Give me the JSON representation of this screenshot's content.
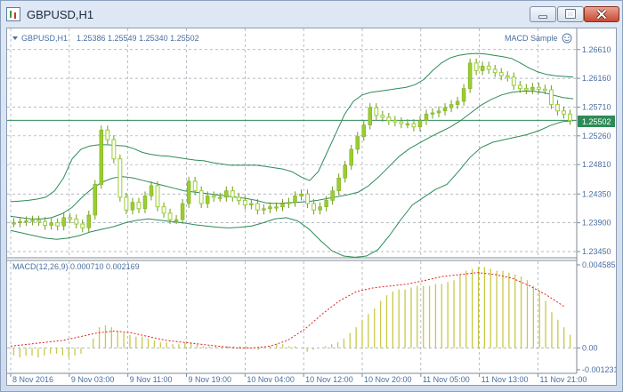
{
  "window": {
    "title": "GBPUSD,H1",
    "icon": "chart-window-icon"
  },
  "main_header": {
    "symbol": "GBPUSD,H1",
    "ohlc": "1.25386 1.25549 1.25340 1.25502",
    "indicator_name": "MACD Sample"
  },
  "macd_header": {
    "label": "MACD(12,26,9) 0.000710 0.002169"
  },
  "current_price": "1.25502",
  "colors": {
    "candle_bull": "#9acd32",
    "candle_bear": "#9acd32",
    "bands": "#2e8b57",
    "price_line": "#2e8b57",
    "macd_hist": "#c8c84a",
    "macd_signal": "#e02020",
    "grid": "#9aa3ad",
    "text": "#4a6fa0"
  },
  "chart_data": [
    {
      "type": "candlestick",
      "title": "GBPUSD,H1",
      "y_ticks": [
        "1.26610",
        "1.26160",
        "1.25710",
        "1.25260",
        "1.24810",
        "1.24350",
        "1.23900",
        "1.23450"
      ],
      "ylim": [
        1.2338,
        1.2669
      ],
      "x_ticks": [
        "8 Nov 2016",
        "9 Nov 03:00",
        "9 Nov 11:00",
        "9 Nov 19:00",
        "10 Nov 04:00",
        "10 Nov 12:00",
        "10 Nov 20:00",
        "11 Nov 05:00",
        "11 Nov 13:00",
        "11 Nov 21:00"
      ],
      "grid": true,
      "closes": [
        1.239,
        1.2392,
        1.2393,
        1.2394,
        1.2392,
        1.2386,
        1.239,
        1.2385,
        1.2398,
        1.2396,
        1.2388,
        1.2382,
        1.2402,
        1.245,
        1.2535,
        1.252,
        1.249,
        1.243,
        1.241,
        1.2422,
        1.2412,
        1.2432,
        1.2448,
        1.2415,
        1.2405,
        1.2395,
        1.2395,
        1.242,
        1.2455,
        1.244,
        1.242,
        1.2432,
        1.243,
        1.243,
        1.244,
        1.243,
        1.2425,
        1.2418,
        1.242,
        1.241,
        1.2412,
        1.2415,
        1.2415,
        1.242,
        1.2422,
        1.2432,
        1.2435,
        1.242,
        1.241,
        1.2415,
        1.2425,
        1.244,
        1.246,
        1.248,
        1.2505,
        1.2525,
        1.2543,
        1.257,
        1.2558,
        1.2555,
        1.255,
        1.2548,
        1.2545,
        1.2545,
        1.254,
        1.255,
        1.256,
        1.2562,
        1.2565,
        1.257,
        1.2575,
        1.258,
        1.26,
        1.264,
        1.2628,
        1.2635,
        1.263,
        1.2625,
        1.262,
        1.2618,
        1.2605,
        1.26,
        1.2598,
        1.2602,
        1.2599,
        1.2598,
        1.2575,
        1.2565,
        1.256,
        1.255
      ],
      "bands_upper": [
        1.2423,
        1.2424,
        1.2425,
        1.2427,
        1.243,
        1.244,
        1.246,
        1.249,
        1.2505,
        1.251,
        1.2512,
        1.2512,
        1.2511,
        1.251,
        1.2506,
        1.25,
        1.2497,
        1.2495,
        1.2494,
        1.2492,
        1.249,
        1.2488,
        1.2487,
        1.2484,
        1.2482,
        1.248,
        1.248,
        1.248,
        1.248,
        1.2478,
        1.2476,
        1.2474,
        1.247,
        1.2462,
        1.2456,
        1.247,
        1.25,
        1.253,
        1.256,
        1.258,
        1.259,
        1.2594,
        1.2596,
        1.2598,
        1.26,
        1.2602,
        1.2606,
        1.2614,
        1.2628,
        1.264,
        1.2648,
        1.2652,
        1.2654,
        1.2655,
        1.2654,
        1.2652,
        1.265,
        1.2647,
        1.264,
        1.2632,
        1.2626,
        1.2622,
        1.262,
        1.2619,
        1.2618
      ],
      "bands_lower": [
        1.2378,
        1.2374,
        1.237,
        1.2366,
        1.2364,
        1.2366,
        1.237,
        1.2376,
        1.238,
        1.2384,
        1.239,
        1.2394,
        1.2396,
        1.2394,
        1.2392,
        1.239,
        1.2387,
        1.2385,
        1.2383,
        1.2382,
        1.2383,
        1.2385,
        1.239,
        1.2396,
        1.2398,
        1.2393,
        1.238,
        1.2362,
        1.2346,
        1.2338,
        1.2336,
        1.2338,
        1.2348,
        1.237,
        1.2395,
        1.2418,
        1.243,
        1.2442,
        1.245,
        1.247,
        1.2492,
        1.2508,
        1.2516,
        1.252,
        1.2524,
        1.2528,
        1.2534,
        1.2542,
        1.2548,
        1.255
      ],
      "bands_middle": [
        1.24,
        1.2398,
        1.2396,
        1.2396,
        1.2398,
        1.2404,
        1.2414,
        1.243,
        1.2444,
        1.2454,
        1.246,
        1.2462,
        1.246,
        1.2456,
        1.2452,
        1.2448,
        1.2444,
        1.244,
        1.2438,
        1.2436,
        1.2434,
        1.2432,
        1.243,
        1.2428,
        1.2425,
        1.2421,
        1.242,
        1.2421,
        1.2422,
        1.2423,
        1.2425,
        1.2428,
        1.2431,
        1.2434,
        1.2438,
        1.2448,
        1.2462,
        1.2478,
        1.2494,
        1.2506,
        1.2515,
        1.2524,
        1.2532,
        1.254,
        1.255,
        1.2562,
        1.2574,
        1.2583,
        1.259,
        1.2594,
        1.2596,
        1.2596,
        1.2594,
        1.259,
        1.2586,
        1.2584
      ]
    },
    {
      "type": "bar",
      "title": "MACD(12,26,9) 0.000710 0.002169",
      "y_ticks": [
        "0.004585",
        "0.00",
        "-0.001231"
      ],
      "ylim": [
        -0.00125,
        0.0046
      ],
      "macd_hist": [
        -0.0004,
        -0.0005,
        -0.0004,
        -0.0004,
        -0.0005,
        -0.0004,
        -0.0003,
        -0.0003,
        -0.0004,
        -0.0005,
        -0.0004,
        -0.0003,
        0.0,
        0.0005,
        0.0011,
        0.0012,
        0.0011,
        0.0009,
        0.0008,
        0.0007,
        0.0006,
        0.0006,
        0.0005,
        0.0004,
        0.0003,
        0.0003,
        0.0002,
        0.0002,
        0.0003,
        0.0003,
        0.0002,
        0.0001,
        0.0001,
        0.0001,
        0.0001,
        0.0001,
        0.0001,
        0.0001,
        0.0001,
        0.0,
        -0.0001,
        0.0,
        0.0001,
        0.0002,
        0.0002,
        0.0001,
        0.0001,
        0.0,
        -0.0002,
        -0.0001,
        0.0,
        0.0001,
        0.0002,
        0.0003,
        0.0005,
        0.0008,
        0.0011,
        0.0015,
        0.0018,
        0.0021,
        0.0025,
        0.0028,
        0.003,
        0.0031,
        0.0031,
        0.0032,
        0.0033,
        0.0033,
        0.0033,
        0.0034,
        0.0034,
        0.0035,
        0.0036,
        0.0039,
        0.0041,
        0.0042,
        0.0043,
        0.0043,
        0.0042,
        0.0041,
        0.0041,
        0.004,
        0.0039,
        0.0038,
        0.0036,
        0.0033,
        0.003,
        0.0025,
        0.0019,
        0.0015,
        0.0011,
        0.0007
      ],
      "macd_signal": [
        0.0001,
        0.0002,
        0.0003,
        0.0004,
        0.0006,
        0.0008,
        0.0009,
        0.0008,
        0.0006,
        0.0004,
        0.0003,
        0.0002,
        0.0001,
        0.0,
        0.0,
        0.0001,
        0.0004,
        0.001,
        0.0018,
        0.0025,
        0.003,
        0.0032,
        0.0033,
        0.0034,
        0.0036,
        0.0038,
        0.0039,
        0.004,
        0.0039,
        0.0037,
        0.0033,
        0.0028,
        0.0022
      ]
    }
  ]
}
